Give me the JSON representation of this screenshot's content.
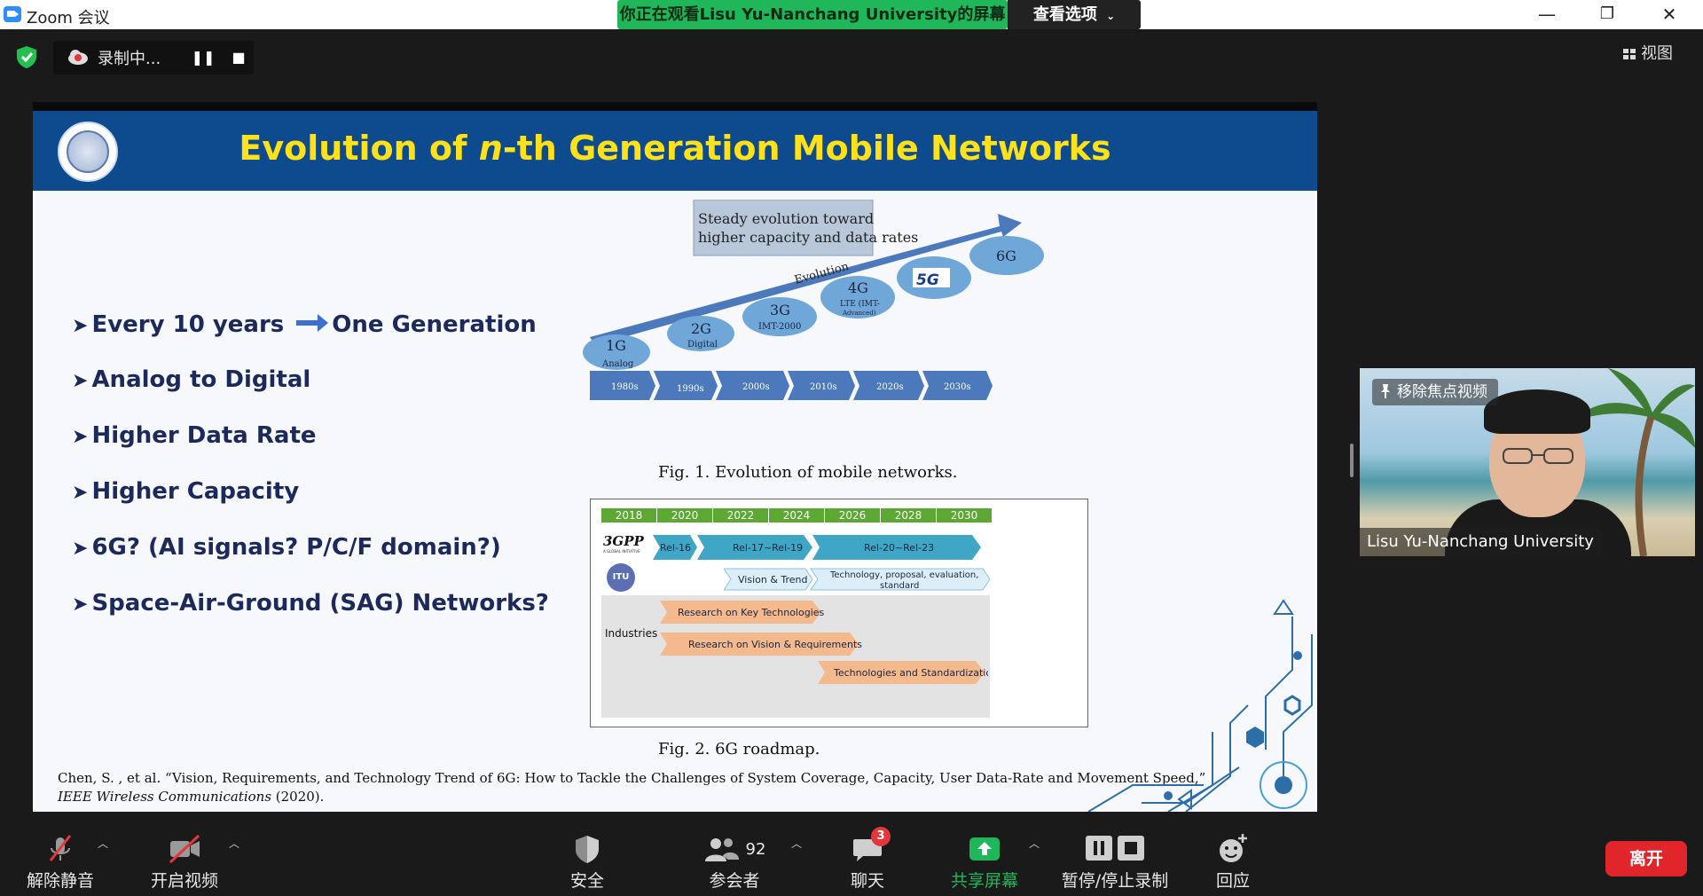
{
  "window": {
    "app_title": "Zoom 会议",
    "share_banner": "你正在观看Lisu Yu-Nanchang University的屏幕",
    "view_options": "查看选项",
    "minimize": "—",
    "restore": "❐",
    "close": "✕"
  },
  "recording": {
    "status": "录制中...",
    "pause_icon": "pause-icon",
    "stop_icon": "stop-icon"
  },
  "view_button": "视图",
  "slide": {
    "title_pre": "Evolution of ",
    "title_n": "n",
    "title_post": "-th Generation Mobile Networks",
    "bullets": [
      {
        "text_a": "Every 10 years",
        "text_b": "One Generation"
      },
      {
        "text": "Analog to Digital"
      },
      {
        "text": "Higher Data Rate"
      },
      {
        "text": "Higher Capacity"
      },
      {
        "text": "6G? (AI signals? P/C/F domain?)"
      },
      {
        "text": "Space-Air-Ground (SAG) Networks?"
      }
    ],
    "fig1": {
      "box_line1": "Steady evolution toward",
      "box_line2": "higher capacity and data rates",
      "arrow_label": "Evolution",
      "generations": [
        {
          "name": "1G",
          "sub": "Analog"
        },
        {
          "name": "2G",
          "sub": "Digital"
        },
        {
          "name": "3G",
          "sub": "IMT-2000"
        },
        {
          "name": "4G",
          "sub": "LTE (IMT-",
          "sub2": "Advanced)"
        },
        {
          "name": "5G",
          "sub": ""
        },
        {
          "name": "6G",
          "sub": ""
        }
      ],
      "decades": [
        "1980s",
        "1990s",
        "2000s",
        "2010s",
        "2020s",
        "2030s"
      ],
      "caption": "Fig. 1.  Evolution of mobile networks."
    },
    "fig2": {
      "years": [
        "2018",
        "2020",
        "2022",
        "2024",
        "2026",
        "2028",
        "2030"
      ],
      "org_3gpp": "3GPP",
      "org_3gpp_sub": "A GLOBAL INITIATIVE",
      "org_itu": "ITU",
      "rel_16": "Rel-16",
      "rel_17_19": "Rel-17~Rel-19",
      "rel_20_23": "Rel-20~Rel-23",
      "vision_trend": "Vision & Trend",
      "tech_proposal_1": "Technology, proposal, evaluation,",
      "tech_proposal_2": "standard",
      "industries_label": "Industries",
      "research_key": "Research on Key Technologies",
      "research_vision": "Research on Vision & Requirements",
      "tech_standard": "Technologies and Standardization",
      "caption": "Fig. 2. 6G roadmap."
    },
    "citation_line1": "Chen, S. , et al. “Vision, Requirements, and Technology Trend of 6G: How to Tackle the Challenges of System Coverage, Capacity, User Data-Rate and Movement Speed,”",
    "citation_journal": "IEEE Wireless Communications",
    "citation_year": " (2020)."
  },
  "video": {
    "unpin_label": "移除焦点视频",
    "participant_name": "Lisu Yu-Nanchang University"
  },
  "toolbar": {
    "unmute": "解除静音",
    "start_video": "开启视频",
    "security": "安全",
    "participants": "参会者",
    "participant_count": "92",
    "chat": "聊天",
    "chat_badge": "3",
    "share_screen": "共享屏幕",
    "pause_stop_recording": "暂停/停止录制",
    "reactions": "回应",
    "leave": "离开"
  },
  "colors": {
    "share_green": "#1fb75a",
    "slide_header_blue": "#0d4a8e",
    "slide_title_yellow": "#ffe11a",
    "leave_red": "#e0252b"
  }
}
